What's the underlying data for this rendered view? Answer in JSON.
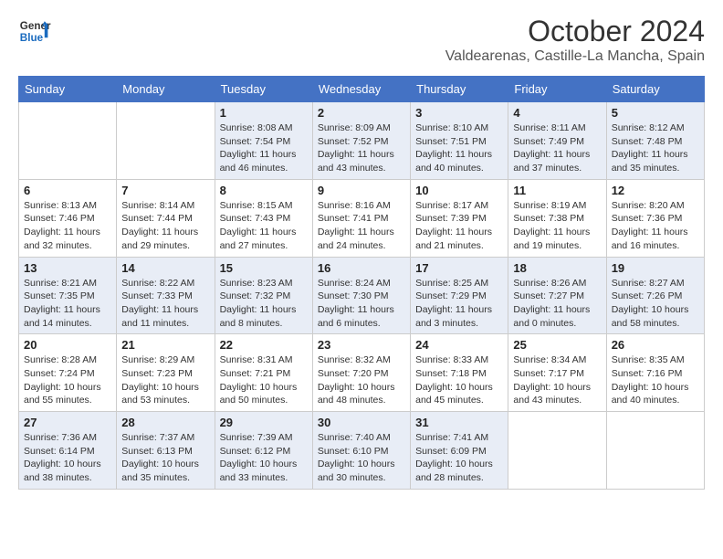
{
  "header": {
    "logo_line1": "General",
    "logo_line2": "Blue",
    "main_title": "October 2024",
    "subtitle": "Valdearenas, Castille-La Mancha, Spain"
  },
  "weekdays": [
    "Sunday",
    "Monday",
    "Tuesday",
    "Wednesday",
    "Thursday",
    "Friday",
    "Saturday"
  ],
  "weeks": [
    [
      {
        "day": "",
        "info": ""
      },
      {
        "day": "",
        "info": ""
      },
      {
        "day": "1",
        "info": "Sunrise: 8:08 AM\nSunset: 7:54 PM\nDaylight: 11 hours and 46 minutes."
      },
      {
        "day": "2",
        "info": "Sunrise: 8:09 AM\nSunset: 7:52 PM\nDaylight: 11 hours and 43 minutes."
      },
      {
        "day": "3",
        "info": "Sunrise: 8:10 AM\nSunset: 7:51 PM\nDaylight: 11 hours and 40 minutes."
      },
      {
        "day": "4",
        "info": "Sunrise: 8:11 AM\nSunset: 7:49 PM\nDaylight: 11 hours and 37 minutes."
      },
      {
        "day": "5",
        "info": "Sunrise: 8:12 AM\nSunset: 7:48 PM\nDaylight: 11 hours and 35 minutes."
      }
    ],
    [
      {
        "day": "6",
        "info": "Sunrise: 8:13 AM\nSunset: 7:46 PM\nDaylight: 11 hours and 32 minutes."
      },
      {
        "day": "7",
        "info": "Sunrise: 8:14 AM\nSunset: 7:44 PM\nDaylight: 11 hours and 29 minutes."
      },
      {
        "day": "8",
        "info": "Sunrise: 8:15 AM\nSunset: 7:43 PM\nDaylight: 11 hours and 27 minutes."
      },
      {
        "day": "9",
        "info": "Sunrise: 8:16 AM\nSunset: 7:41 PM\nDaylight: 11 hours and 24 minutes."
      },
      {
        "day": "10",
        "info": "Sunrise: 8:17 AM\nSunset: 7:39 PM\nDaylight: 11 hours and 21 minutes."
      },
      {
        "day": "11",
        "info": "Sunrise: 8:19 AM\nSunset: 7:38 PM\nDaylight: 11 hours and 19 minutes."
      },
      {
        "day": "12",
        "info": "Sunrise: 8:20 AM\nSunset: 7:36 PM\nDaylight: 11 hours and 16 minutes."
      }
    ],
    [
      {
        "day": "13",
        "info": "Sunrise: 8:21 AM\nSunset: 7:35 PM\nDaylight: 11 hours and 14 minutes."
      },
      {
        "day": "14",
        "info": "Sunrise: 8:22 AM\nSunset: 7:33 PM\nDaylight: 11 hours and 11 minutes."
      },
      {
        "day": "15",
        "info": "Sunrise: 8:23 AM\nSunset: 7:32 PM\nDaylight: 11 hours and 8 minutes."
      },
      {
        "day": "16",
        "info": "Sunrise: 8:24 AM\nSunset: 7:30 PM\nDaylight: 11 hours and 6 minutes."
      },
      {
        "day": "17",
        "info": "Sunrise: 8:25 AM\nSunset: 7:29 PM\nDaylight: 11 hours and 3 minutes."
      },
      {
        "day": "18",
        "info": "Sunrise: 8:26 AM\nSunset: 7:27 PM\nDaylight: 11 hours and 0 minutes."
      },
      {
        "day": "19",
        "info": "Sunrise: 8:27 AM\nSunset: 7:26 PM\nDaylight: 10 hours and 58 minutes."
      }
    ],
    [
      {
        "day": "20",
        "info": "Sunrise: 8:28 AM\nSunset: 7:24 PM\nDaylight: 10 hours and 55 minutes."
      },
      {
        "day": "21",
        "info": "Sunrise: 8:29 AM\nSunset: 7:23 PM\nDaylight: 10 hours and 53 minutes."
      },
      {
        "day": "22",
        "info": "Sunrise: 8:31 AM\nSunset: 7:21 PM\nDaylight: 10 hours and 50 minutes."
      },
      {
        "day": "23",
        "info": "Sunrise: 8:32 AM\nSunset: 7:20 PM\nDaylight: 10 hours and 48 minutes."
      },
      {
        "day": "24",
        "info": "Sunrise: 8:33 AM\nSunset: 7:18 PM\nDaylight: 10 hours and 45 minutes."
      },
      {
        "day": "25",
        "info": "Sunrise: 8:34 AM\nSunset: 7:17 PM\nDaylight: 10 hours and 43 minutes."
      },
      {
        "day": "26",
        "info": "Sunrise: 8:35 AM\nSunset: 7:16 PM\nDaylight: 10 hours and 40 minutes."
      }
    ],
    [
      {
        "day": "27",
        "info": "Sunrise: 7:36 AM\nSunset: 6:14 PM\nDaylight: 10 hours and 38 minutes."
      },
      {
        "day": "28",
        "info": "Sunrise: 7:37 AM\nSunset: 6:13 PM\nDaylight: 10 hours and 35 minutes."
      },
      {
        "day": "29",
        "info": "Sunrise: 7:39 AM\nSunset: 6:12 PM\nDaylight: 10 hours and 33 minutes."
      },
      {
        "day": "30",
        "info": "Sunrise: 7:40 AM\nSunset: 6:10 PM\nDaylight: 10 hours and 30 minutes."
      },
      {
        "day": "31",
        "info": "Sunrise: 7:41 AM\nSunset: 6:09 PM\nDaylight: 10 hours and 28 minutes."
      },
      {
        "day": "",
        "info": ""
      },
      {
        "day": "",
        "info": ""
      }
    ]
  ]
}
